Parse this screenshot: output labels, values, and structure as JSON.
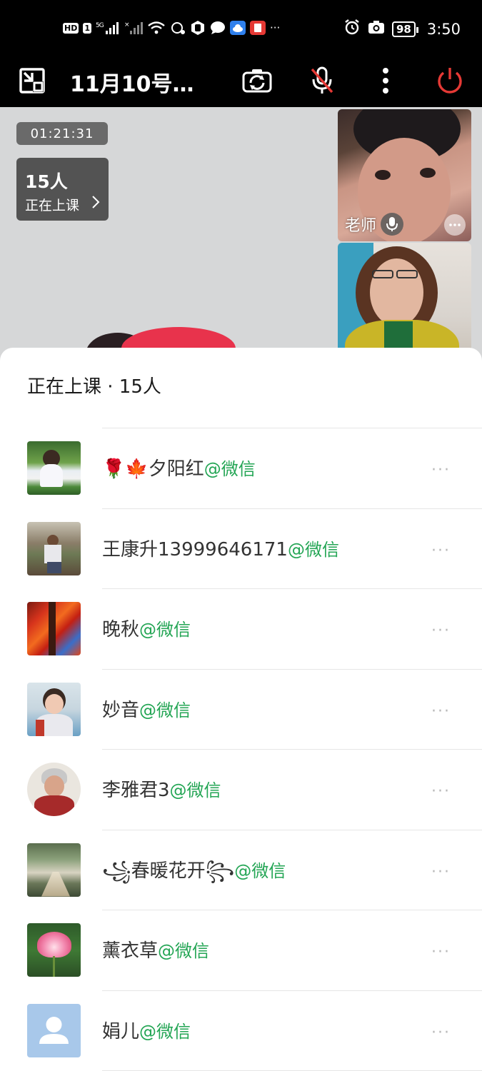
{
  "status_bar": {
    "hd": "HD",
    "sim": "1",
    "net": "5G",
    "time": "3:50",
    "battery": "98",
    "more": "···"
  },
  "toolbar": {
    "title": "11月10号…"
  },
  "video": {
    "timer": "01:21:31",
    "count": "15人",
    "count_label": "正在上课",
    "teacher_label": "老师"
  },
  "sheet": {
    "title": "正在上课 · 15人",
    "participants": [
      {
        "name": "🌹🍁夕阳红",
        "tag": "@微信"
      },
      {
        "name": "王康升13999646171",
        "tag": "@微信"
      },
      {
        "name": "晚秋",
        "tag": "@微信"
      },
      {
        "name": "妙音",
        "tag": "@微信"
      },
      {
        "name": "李雅君3",
        "tag": "@微信"
      },
      {
        "name": "꧁春暖花开꧂",
        "tag": "@微信"
      },
      {
        "name": "薰衣草",
        "tag": "@微信"
      },
      {
        "name": "娟儿",
        "tag": "@微信"
      }
    ],
    "more_glyph": "···"
  },
  "colors": {
    "accent_green": "#23a554",
    "hangup_red": "#e53935",
    "mute_red": "#e53935"
  }
}
